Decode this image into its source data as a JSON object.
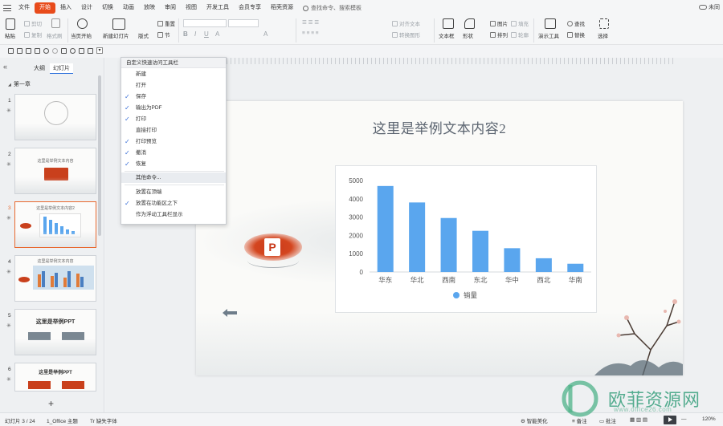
{
  "menubar": {
    "items": [
      "文件",
      "开始",
      "插入",
      "设计",
      "切换",
      "动画",
      "放映",
      "审阅",
      "视图",
      "开发工具",
      "会员专享",
      "稻壳资源"
    ],
    "active_index": 1,
    "search_label": "查找命令、搜索模板",
    "sync_label": "未同"
  },
  "ribbon": {
    "paste": "粘贴",
    "cut": "剪切",
    "copy": "复制",
    "format_painter": "格式刷",
    "from_current": "当页开始",
    "new_slide": "新建幻灯片",
    "layout": "版式",
    "section": "节",
    "reset": "重置",
    "text_direction": "对齐文本",
    "convert_smartart": "转换图形",
    "textbox": "文本框",
    "shape": "形状",
    "arrange": "排列",
    "picture": "图片",
    "fill": "填充",
    "outline": "轮廓",
    "presentation_tools": "演示工具",
    "find": "查找",
    "replace": "替换",
    "select": "选择"
  },
  "panel": {
    "tab_outline": "大纲",
    "tab_slides": "幻灯片",
    "section_title": "第一章",
    "thumbs": [
      {
        "num": "1",
        "title": ""
      },
      {
        "num": "2",
        "title": "这里是举例文本内容"
      },
      {
        "num": "3",
        "title": "这里是举例文本内容2"
      },
      {
        "num": "4",
        "title": "这里是举例文本内容"
      },
      {
        "num": "5",
        "title": "这里是举例PPT"
      },
      {
        "num": "6",
        "title": "这里是举例PPT"
      }
    ]
  },
  "dropdown": {
    "header": "自定义快速访问工具栏",
    "items": [
      {
        "label": "新建",
        "checked": false
      },
      {
        "label": "打开",
        "checked": false
      },
      {
        "label": "保存",
        "checked": true
      },
      {
        "label": "输出为PDF",
        "checked": true
      },
      {
        "label": "打印",
        "checked": true
      },
      {
        "label": "直接打印",
        "checked": false
      },
      {
        "label": "打印预览",
        "checked": true
      },
      {
        "label": "撤消",
        "checked": true
      },
      {
        "label": "恢复",
        "checked": true
      }
    ],
    "more": "其他命令...",
    "position_items": [
      {
        "label": "放置在顶端",
        "checked": false
      },
      {
        "label": "放置在功能区之下",
        "checked": true
      },
      {
        "label": "作为浮动工具栏显示",
        "checked": false
      }
    ]
  },
  "slide": {
    "title": "这里是举例文本内容2"
  },
  "chart_data": {
    "type": "bar",
    "categories": [
      "华东",
      "华北",
      "西南",
      "东北",
      "华中",
      "西北",
      "华南"
    ],
    "series": [
      {
        "name": "销量",
        "values": [
          4700,
          3800,
          2950,
          2250,
          1300,
          750,
          450
        ]
      }
    ],
    "yticks": [
      "0",
      "1000",
      "2000",
      "3000",
      "4000",
      "5000"
    ],
    "ylim": [
      0,
      5000
    ],
    "bar_color": "#5aa6ee",
    "legend_position": "bottom"
  },
  "statusbar": {
    "slide_info": "幻灯片 3 / 24",
    "theme": "1_Office 主题",
    "missing_font": "缺失字体",
    "smart_beautify": "智能美化",
    "notes": "备注",
    "comments": "批注",
    "zoom": "120%"
  },
  "watermark": {
    "text": "欧菲资源网",
    "url": "www.office26.com"
  },
  "colors": {
    "accent": "#e84b1b",
    "check": "#3a6fd8",
    "bar": "#5aa6ee"
  }
}
